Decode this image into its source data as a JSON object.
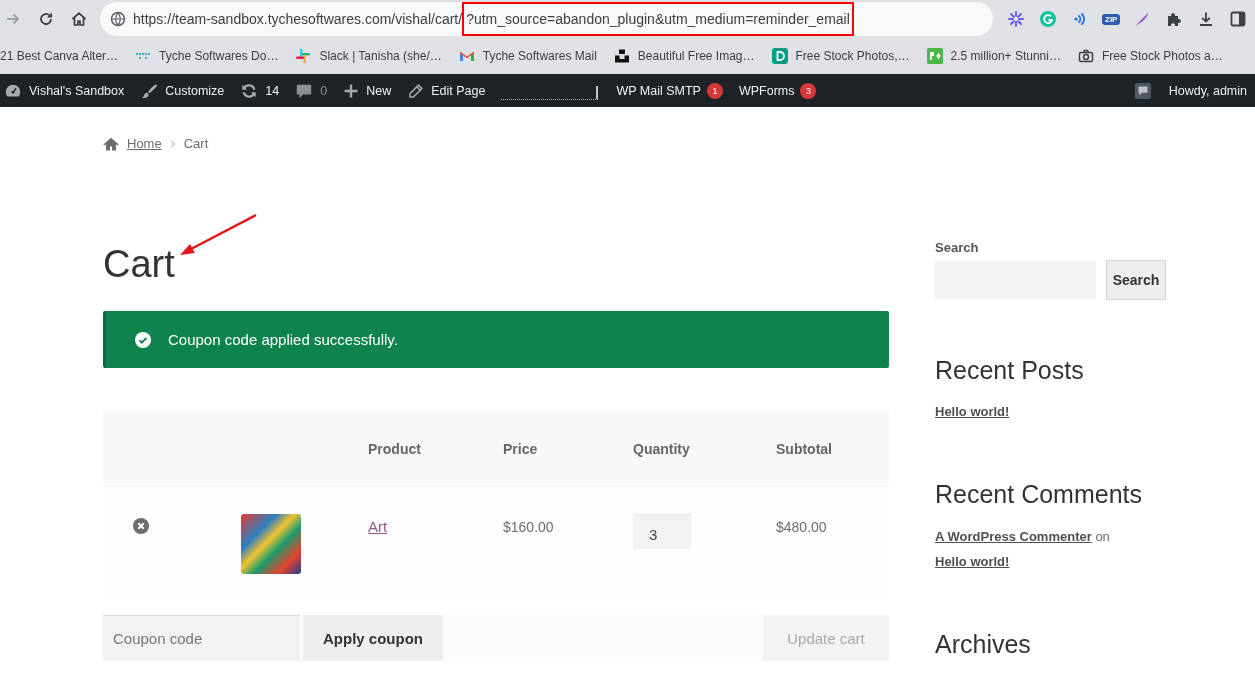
{
  "browser": {
    "forward_disabled": true,
    "url": "https://team-sandbox.tychesoftwares.com/vishal/cart/",
    "url_highlighted": "?utm_source=abandon_plugin&utm_medium=reminder_email",
    "extension_badge": "ZIP"
  },
  "bookmarks": [
    {
      "label": "21 Best Canva Alter…"
    },
    {
      "label": "Tyche Softwares Do…"
    },
    {
      "label": "Slack | Tanisha (she/…"
    },
    {
      "label": "Tyche Softwares Mail"
    },
    {
      "label": "Beautiful Free Imag…"
    },
    {
      "label": "Free Stock Photos,…"
    },
    {
      "label": "2.5 million+ Stunni…"
    },
    {
      "label": "Free Stock Photos a…"
    }
  ],
  "admin_bar": {
    "items": [
      {
        "kind": "site",
        "label": "Vishal's Sandbox"
      },
      {
        "kind": "customize",
        "label": "Customize"
      },
      {
        "kind": "updates",
        "label": "14"
      },
      {
        "kind": "comments",
        "label": "0"
      },
      {
        "kind": "new",
        "label": "New"
      },
      {
        "kind": "edit",
        "label": "Edit Page"
      }
    ],
    "plugins": [
      {
        "label": "WP Mail SMTP",
        "count": "1"
      },
      {
        "label": "WPForms",
        "count": "3"
      }
    ],
    "greeting": "Howdy, admin"
  },
  "breadcrumb": [
    {
      "kind": "link",
      "label": "Home"
    },
    {
      "kind": "current",
      "label": "Cart"
    }
  ],
  "page_title": "Cart",
  "notice": {
    "text": "Coupon code applied successfully."
  },
  "cart_table": {
    "columns": [
      "Product",
      "Price",
      "Quantity",
      "Subtotal"
    ],
    "rows": [
      {
        "product": "Art",
        "price": "$160.00",
        "quantity": "3",
        "subtotal": "$480.00"
      }
    ]
  },
  "cart_actions": {
    "coupon_placeholder": "Coupon code",
    "apply_button": {
      "label": "Apply coupon",
      "disabled": false
    },
    "update_button": {
      "label": "Update cart",
      "disabled": true
    }
  },
  "sidebar": {
    "search": {
      "label": "Search",
      "button": "Search"
    },
    "widgets": [
      {
        "kind": "posts",
        "title": "Recent Posts",
        "posts": [
          "Hello world!"
        ]
      },
      {
        "kind": "comments",
        "title": "Recent Comments",
        "comments": [
          {
            "author": "A WordPress Commenter",
            "connector": "on",
            "post": "Hello world!"
          }
        ]
      },
      {
        "kind": "archives",
        "title": "Archives"
      }
    ]
  }
}
